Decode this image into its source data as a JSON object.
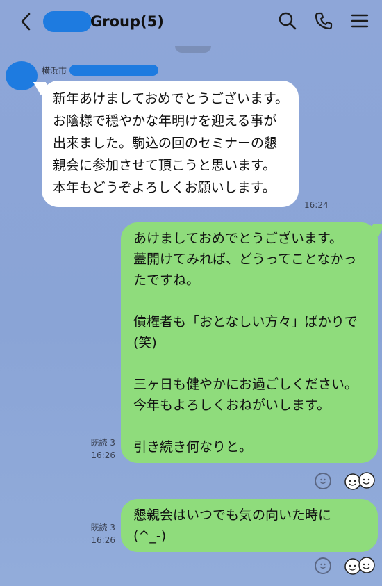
{
  "header": {
    "group_title": "Group(5)"
  },
  "messages": {
    "incoming": {
      "sender_prefix": "横浜市",
      "text": "新年あけましておめでとうございます。お陰様で穏やかな年明けを迎える事が出来ました。駒込の回のセミナーの懇親会に参加させて頂こうと思います。本年もどうぞよろしくお願いします。",
      "time": "16:24"
    },
    "outgoing_1": {
      "text": "あけましておめでとうございます。\n蓋開けてみれば、どうってことなかったですね。\n\n債権者も「おとなしい方々」ばかりで(笑)\n\n三ヶ日も健やかにお過ごしください。\n今年もよろしくおねがいします。\n\n引き続き何なりと。",
      "read": "既読 3",
      "time": "16:26"
    },
    "outgoing_2": {
      "text": "懇親会はいつでも気の向いた時に\n(^_-)",
      "read": "既読 3",
      "time": "16:26"
    }
  },
  "icons": {
    "back": "chevron-left-icon",
    "search": "search-icon",
    "call": "phone-icon",
    "menu": "hamburger-menu-icon",
    "reaction": "smile-reaction-icon",
    "sticker": "sticker-faces-icon"
  },
  "colors": {
    "background": "#8ea6d8",
    "incoming_bubble": "#ffffff",
    "outgoing_bubble": "#8fdc7c",
    "redaction": "#1e7be0"
  }
}
